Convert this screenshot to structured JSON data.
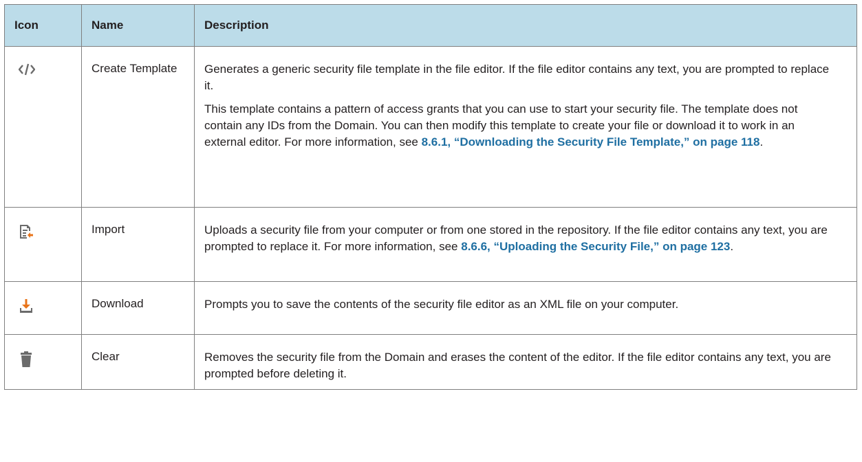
{
  "header": {
    "icon": "Icon",
    "name": "Name",
    "description": "Description"
  },
  "rows": [
    {
      "icon": "code-icon",
      "name": "Create Template",
      "paragraphs": [
        {
          "text": "Generates a generic security file template in the file editor. If the file editor contains any text, you are prompted to replace it."
        },
        {
          "text": "This template contains a pattern of access grants that you can use to start your security file. The template does not contain any IDs from the Domain. You can then modify this template to create your file or download it to work in an external editor. For more information, see ",
          "link": "8.6.1, “Downloading the Security File Template,” on page 118",
          "after": "."
        }
      ]
    },
    {
      "icon": "import-icon",
      "name": "Import",
      "paragraphs": [
        {
          "text": "Uploads a security file from your computer or from one stored in the repository. If the file editor contains any text, you are prompted to replace it. For more information, see ",
          "link": "8.6.6, “Uploading the Security File,” on page 123",
          "after": "."
        }
      ]
    },
    {
      "icon": "download-icon",
      "name": "Download",
      "paragraphs": [
        {
          "text": "Prompts you to save the contents of the security file editor as an XML file on your computer."
        }
      ]
    },
    {
      "icon": "trash-icon",
      "name": "Clear",
      "paragraphs": [
        {
          "text": "Removes the security file from the Domain and erases the content of the editor. If the file editor contains any text, you are prompted before deleting it."
        }
      ]
    }
  ],
  "colors": {
    "header_bg": "#bcdce9",
    "link": "#1f6fa2",
    "icon_gray": "#6b6b6b",
    "icon_orange": "#e8741a"
  }
}
